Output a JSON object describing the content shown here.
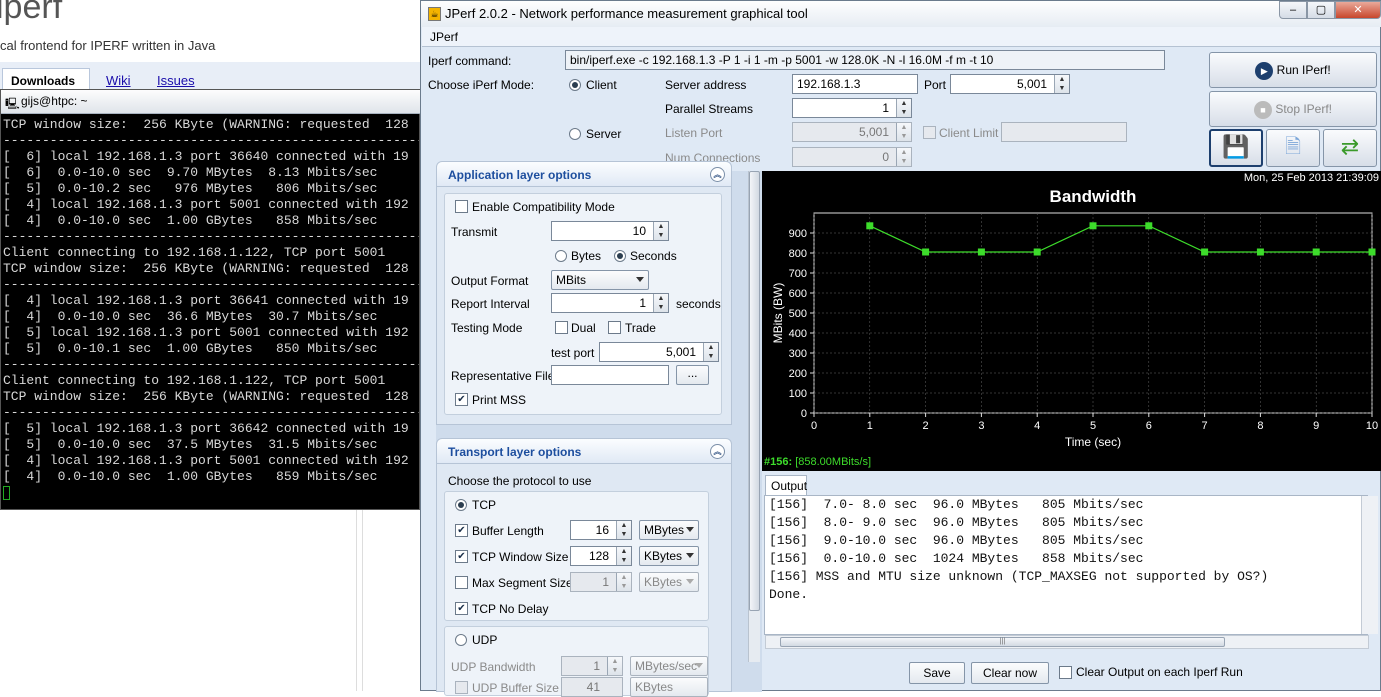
{
  "web": {
    "title": "iperf",
    "subtitle": "cal frontend for IPERF written in Java",
    "tabs": [
      "Downloads",
      "Wiki",
      "Issues"
    ]
  },
  "terminal": {
    "title": "gijs@htpc: ~",
    "lines": [
      "TCP window size:  256 KByte (WARNING: requested  128",
      "------------------------------------------------------------",
      "[  6] local 192.168.1.3 port 36640 connected with 19",
      "[  6]  0.0-10.0 sec  9.70 MBytes  8.13 Mbits/sec",
      "[  5]  0.0-10.2 sec   976 MBytes   806 Mbits/sec",
      "[  4] local 192.168.1.3 port 5001 connected with 192",
      "[  4]  0.0-10.0 sec  1.00 GBytes   858 Mbits/sec",
      "------------------------------------------------------------",
      "Client connecting to 192.168.1.122, TCP port 5001",
      "TCP window size:  256 KByte (WARNING: requested  128",
      "------------------------------------------------------------",
      "[  4] local 192.168.1.3 port 36641 connected with 19",
      "[  4]  0.0-10.0 sec  36.6 MBytes  30.7 Mbits/sec",
      "[  5] local 192.168.1.3 port 5001 connected with 192",
      "[  5]  0.0-10.1 sec  1.00 GBytes   850 Mbits/sec",
      "------------------------------------------------------------",
      "Client connecting to 192.168.1.122, TCP port 5001",
      "TCP window size:  256 KByte (WARNING: requested  128",
      "------------------------------------------------------------",
      "[  5] local 192.168.1.3 port 36642 connected with 19",
      "[  5]  0.0-10.0 sec  37.5 MBytes  31.5 Mbits/sec",
      "[  4] local 192.168.1.3 port 5001 connected with 192",
      "[  4]  0.0-10.0 sec  1.00 GBytes   859 Mbits/sec"
    ]
  },
  "jperf": {
    "title": "JPerf 2.0.2 - Network performance measurement graphical tool",
    "menu": "JPerf",
    "command_label": "Iperf command:",
    "command": "bin/iperf.exe -c 192.168.1.3 -P 1 -i 1 -m -p 5001 -w 128.0K -N -l 16.0M -f m -t 10",
    "mode_label": "Choose iPerf Mode:",
    "client_label": "Client",
    "server_label": "Server",
    "server_address_label": "Server address",
    "server_address": "192.168.1.3",
    "port_label": "Port",
    "port": "5,001",
    "parallel_label": "Parallel Streams",
    "parallel": "1",
    "listen_port_label": "Listen Port",
    "listen_port": "5,001",
    "client_limit_label": "Client Limit",
    "num_conn_label": "Num Connections",
    "num_conn": "0",
    "run_button": "Run IPerf!",
    "stop_button": "Stop IPerf!"
  },
  "app_layer": {
    "title": "Application layer options",
    "compat_label": "Enable Compatibility Mode",
    "transmit_label": "Transmit",
    "transmit": "10",
    "bytes_label": "Bytes",
    "seconds_label": "Seconds",
    "output_format_label": "Output Format",
    "output_format": "MBits",
    "report_interval_label": "Report Interval",
    "report_interval": "1",
    "seconds_unit": "seconds",
    "testing_mode_label": "Testing Mode",
    "dual_label": "Dual",
    "trade_label": "Trade",
    "test_port_label": "test port",
    "test_port": "5,001",
    "rep_file_label": "Representative File",
    "browse_label": "...",
    "print_mss_label": "Print MSS"
  },
  "transport_layer": {
    "title": "Transport layer options",
    "protocol_label": "Choose the protocol to use",
    "tcp_label": "TCP",
    "buffer_label": "Buffer Length",
    "buffer": "16",
    "buffer_unit": "MBytes",
    "window_label": "TCP Window Size",
    "window": "128",
    "window_unit": "KBytes",
    "mss_label": "Max Segment Size",
    "mss": "1",
    "mss_unit": "KBytes",
    "nodelay_label": "TCP No Delay",
    "udp_label": "UDP",
    "udp_bw_label": "UDP Bandwidth",
    "udp_bw": "1",
    "udp_bw_unit": "MBytes/sec",
    "udp_buf_label": "UDP Buffer Size",
    "udp_buf": "41",
    "udp_buf_unit": "KBytes"
  },
  "graph": {
    "date": "Mon, 25 Feb 2013 21:39:09",
    "legend": "#156:",
    "legend_value": "[858.00MBits/s]"
  },
  "chart_data": {
    "type": "line",
    "title": "Bandwidth",
    "xlabel": "Time (sec)",
    "ylabel": "MBits (BW)",
    "x": [
      1,
      2,
      3,
      4,
      5,
      6,
      7,
      8,
      9,
      10
    ],
    "series": [
      {
        "name": "#156",
        "values": [
          936,
          805,
          805,
          805,
          936,
          936,
          805,
          805,
          805,
          805
        ],
        "color": "#3ddc2b"
      }
    ],
    "xlim": [
      0,
      10
    ],
    "ylim": [
      0,
      1000
    ],
    "xticks": [
      0,
      1,
      2,
      3,
      4,
      5,
      6,
      7,
      8,
      9,
      10
    ],
    "yticks": [
      0,
      100,
      200,
      300,
      400,
      500,
      600,
      700,
      800,
      900
    ],
    "grid": true,
    "background": "#000000"
  },
  "output": {
    "tab": "Output",
    "lines": [
      "[156]  7.0- 8.0 sec  96.0 MBytes   805 Mbits/sec",
      "[156]  8.0- 9.0 sec  96.0 MBytes   805 Mbits/sec",
      "[156]  9.0-10.0 sec  96.0 MBytes   805 Mbits/sec",
      "[156]  0.0-10.0 sec  1024 MBytes   858 Mbits/sec",
      "[156] MSS and MTU size unknown (TCP_MAXSEG not supported by OS?)",
      "Done."
    ],
    "save_button": "Save",
    "clear_button": "Clear now",
    "clear_each_label": "Clear Output on each Iperf Run"
  }
}
